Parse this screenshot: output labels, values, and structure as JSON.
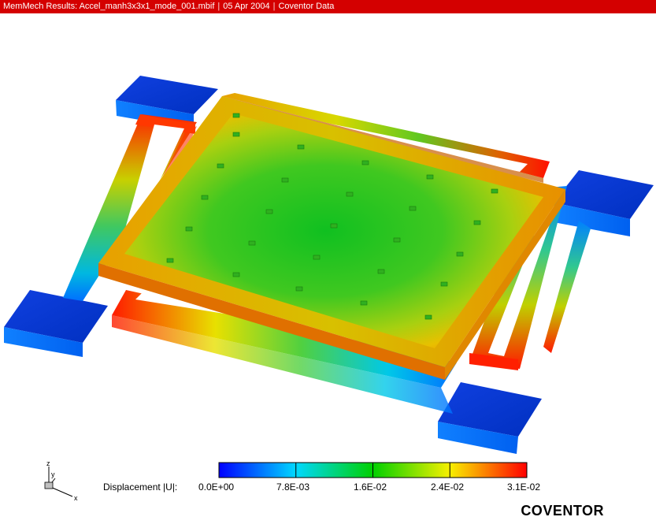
{
  "window": {
    "title_app": "MemMech Results: Accel_manh3x3x1_mode_001.mbif",
    "title_date": "05 Apr 2004",
    "title_source": "Coventor Data"
  },
  "colorbar": {
    "label": "Displacement |U|:",
    "ticks": [
      "0.0E+00",
      "7.8E-03",
      "1.6E-02",
      "2.4E-02",
      "3.1E-02"
    ],
    "colors": [
      "#0000ff",
      "#00c8ff",
      "#00d000",
      "#f0f000",
      "#ff0000"
    ]
  },
  "axes": {
    "z": "z",
    "y": "y",
    "x": "x"
  },
  "brand": "COVENTOR"
}
